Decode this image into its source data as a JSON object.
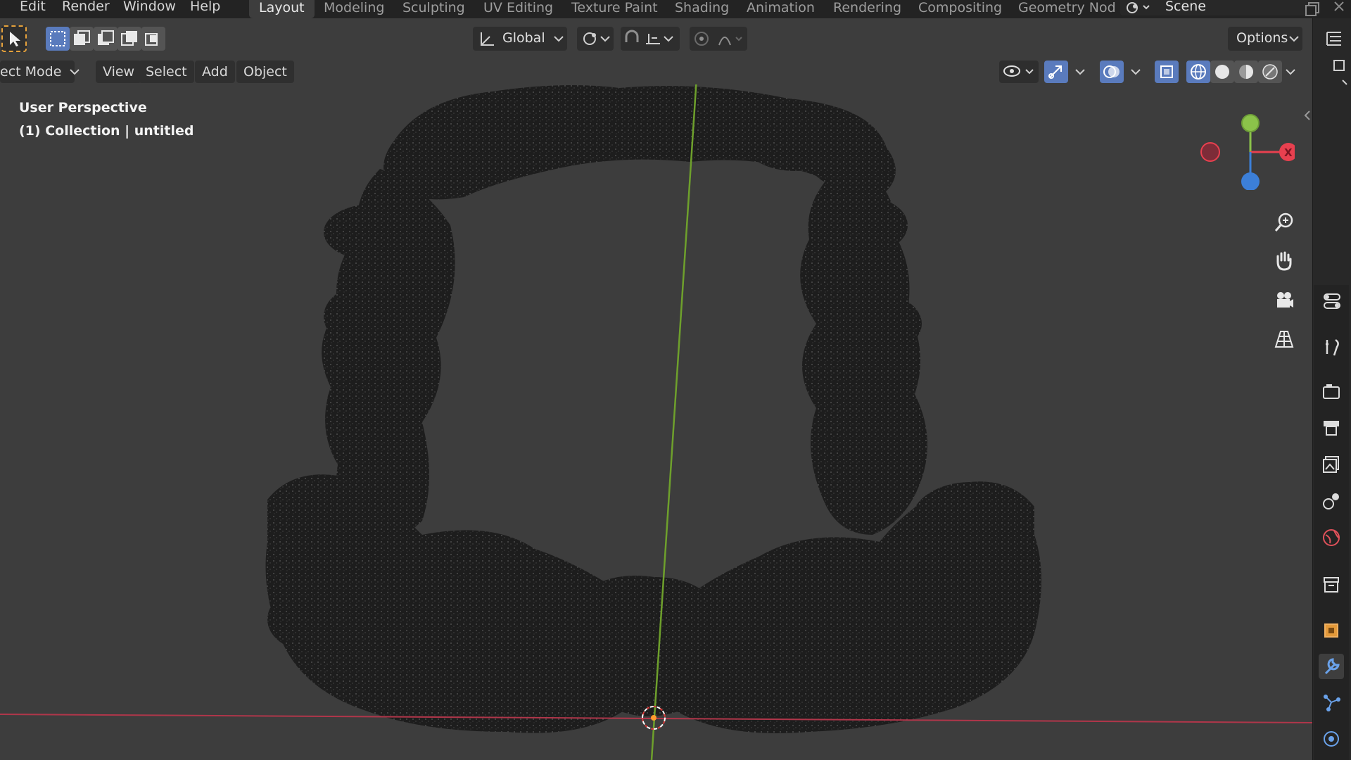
{
  "topbar": {
    "menus": [
      "Edit",
      "Render",
      "Window",
      "Help"
    ],
    "workspace_tabs": [
      "Layout",
      "Modeling",
      "Sculpting",
      "UV Editing",
      "Texture Paint",
      "Shading",
      "Animation",
      "Rendering",
      "Compositing",
      "Geometry Nod"
    ],
    "active_tab": "Layout",
    "scene": "Scene"
  },
  "toolheader": {
    "transform_orientation": "Global",
    "options_label": "Options"
  },
  "viewport_header": {
    "mode": "ect Mode",
    "view": "View",
    "select": "Select",
    "add": "Add",
    "object": "Object"
  },
  "viewport": {
    "perspective_label": "User Perspective",
    "collection_label": "(1) Collection | untitled"
  },
  "gizmo": {
    "x_label": "X",
    "x_color": "#e8404f",
    "y_color": "#8bc34a",
    "z_color": "#3c7fd8"
  },
  "icons": {
    "nav": [
      "zoom-icon",
      "hand-pan-icon",
      "camera-icon",
      "grid-ortho-icon"
    ],
    "props": [
      "tool-icon",
      "render-icon",
      "output-icon",
      "view-layer-icon",
      "scene-icon",
      "world-icon",
      "collection-icon",
      "object-icon",
      "modifier-icon",
      "particles-icon",
      "physics-icon"
    ]
  }
}
